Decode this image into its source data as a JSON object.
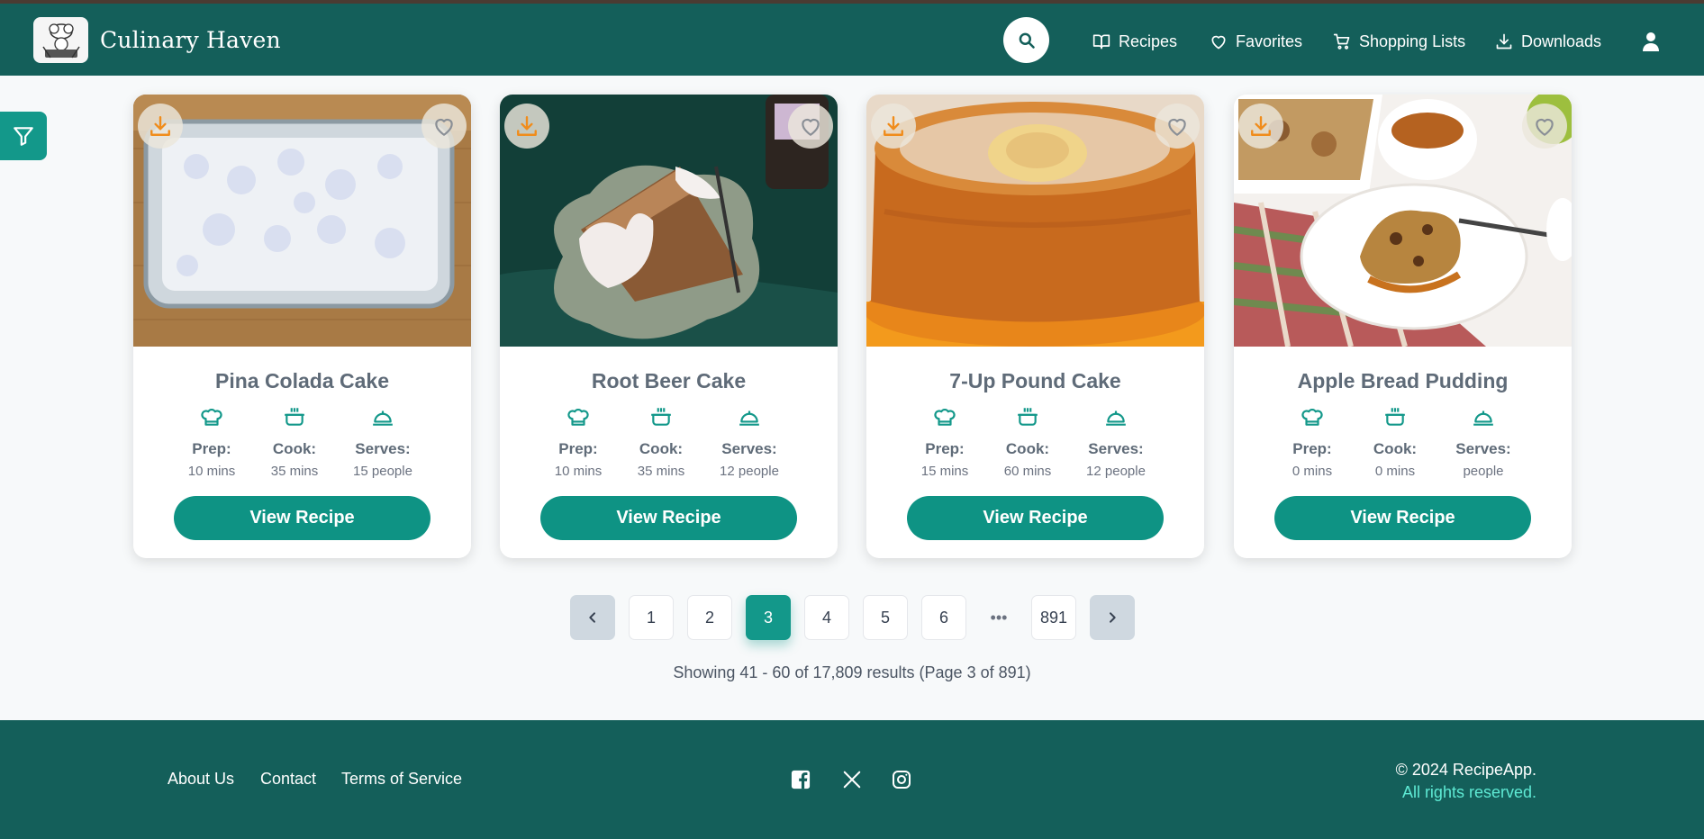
{
  "header": {
    "brand": "Culinary Haven",
    "nav": {
      "recipes": "Recipes",
      "favorites": "Favorites",
      "shopping_lists": "Shopping Lists",
      "downloads": "Downloads"
    },
    "icons": [
      "logo-chef-icon",
      "search-icon",
      "book-icon",
      "heart-icon",
      "cart-icon",
      "download-icon",
      "user-icon"
    ],
    "colors": {
      "bar": "#145f5a",
      "accent": "#0e9384"
    }
  },
  "filter": {
    "icon": "filter-icon"
  },
  "labels": {
    "prep": "Prep:",
    "cook": "Cook:",
    "serves": "Serves:",
    "view_recipe": "View Recipe"
  },
  "recipes": [
    {
      "title": "Pina Colada Cake",
      "prep": "10 mins",
      "cook": "35 mins",
      "serves": "15 people"
    },
    {
      "title": "Root Beer Cake",
      "prep": "10 mins",
      "cook": "35 mins",
      "serves": "12 people"
    },
    {
      "title": "7-Up Pound Cake",
      "prep": "15 mins",
      "cook": "60 mins",
      "serves": "12 people"
    },
    {
      "title": "Apple Bread Pudding",
      "prep": "0 mins",
      "cook": "0 mins",
      "serves": "people"
    }
  ],
  "pagination": {
    "pages": [
      "1",
      "2",
      "3",
      "4",
      "5",
      "6",
      "•••",
      "891"
    ],
    "current": "3",
    "results_text": "Showing 41 - 60 of 17,809 results (Page 3 of 891)"
  },
  "footer": {
    "links": {
      "about": "About Us",
      "contact": "Contact",
      "terms": "Terms of Service"
    },
    "social": [
      "facebook-icon",
      "x-icon",
      "instagram-icon"
    ],
    "copyright": "© 2024 RecipeApp.",
    "rights": "All rights reserved."
  }
}
